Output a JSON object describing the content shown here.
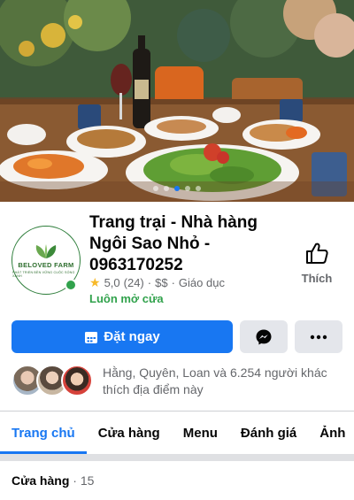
{
  "page": {
    "title": "Trang trại - Nhà hàng Ngôi Sao Nhỏ - 0963170252",
    "avatar": {
      "brand": "BELOVED FARM",
      "tagline": "PHÁT TRIỂN BỀN VỮNG CUỘC SỐNG XANH"
    },
    "rating": "5,0",
    "review_count": "(24)",
    "price": "$$",
    "category": "Giáo dục",
    "separator": "·",
    "open_status": "Luôn mở cửa",
    "like_label": "Thích"
  },
  "actions": {
    "book_label": "Đặt ngay",
    "messenger_icon": "messenger-icon",
    "more_icon": "more-icon"
  },
  "friends": {
    "text": "Hằng, Quyên, Loan và 6.254 người khác thích địa điểm này"
  },
  "tabs": [
    "Trang chủ",
    "Cửa hàng",
    "Menu",
    "Đánh giá",
    "Ảnh"
  ],
  "store": {
    "label": "Cửa hàng",
    "separator": " · ",
    "count": "15"
  },
  "colors": {
    "accent": "#1877f2",
    "online": "#31a24c",
    "star": "#f7b928"
  },
  "cover": {
    "slide_count": 5,
    "active_index": 2
  }
}
